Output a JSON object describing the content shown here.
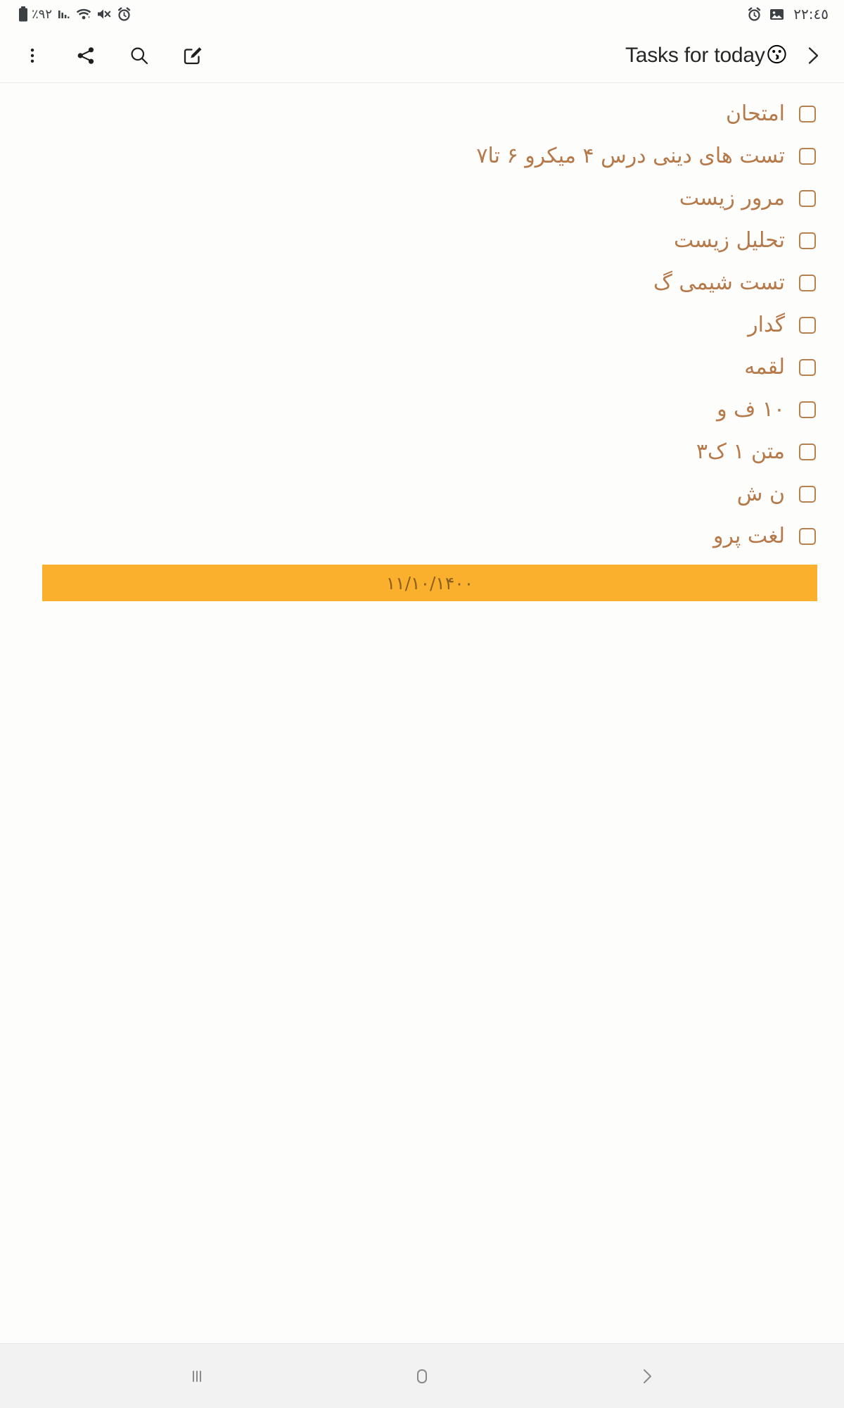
{
  "status_bar": {
    "battery_percent": "٪٩٢",
    "time": "٢٢:٤٥",
    "left_icons": [
      "battery-icon",
      "signal-bars-icon",
      "wifi-icon",
      "mute-icon",
      "alarm-icon"
    ],
    "right_icons": [
      "alarm-icon",
      "image-icon"
    ]
  },
  "toolbar": {
    "overflow_label": "more-options",
    "share_label": "share",
    "search_label": "search",
    "edit_label": "edit",
    "title": "Tasks for today",
    "title_emoji": "😗",
    "next_label": "next"
  },
  "note": {
    "tasks": [
      {
        "text": "امتحان",
        "checked": false
      },
      {
        "text": "تست های دینی درس ۴ میکرو ۶ تا۷",
        "checked": false
      },
      {
        "text": "مرور زیست",
        "checked": false
      },
      {
        "text": "تحلیل زیست",
        "checked": false
      },
      {
        "text": "تست شیمی گ",
        "checked": false
      },
      {
        "text": "گدار",
        "checked": false
      },
      {
        "text": "لقمه",
        "checked": false
      },
      {
        "text": "۱۰ ف و",
        "checked": false
      },
      {
        "text": "متن ۱ ک۳",
        "checked": false
      },
      {
        "text": "ن ش",
        "checked": false
      },
      {
        "text": "لغت پرو",
        "checked": false
      }
    ],
    "date_banner": "۱۱/۱۰/۱۴۰۰"
  },
  "nav_bar": {
    "recents_label": "recent-apps",
    "home_label": "home",
    "back_label": "back"
  },
  "colors": {
    "task_text": "#b5794a",
    "checkbox_border": "#b5814e",
    "banner_bg": "#fbb02d",
    "banner_text": "#8a5f22",
    "page_bg": "#fdfdfc",
    "toolbar_text": "#272727",
    "status_icon": "#3c4043",
    "nav_bg": "#f2f2f2",
    "nav_icon": "#8a8a8a"
  }
}
